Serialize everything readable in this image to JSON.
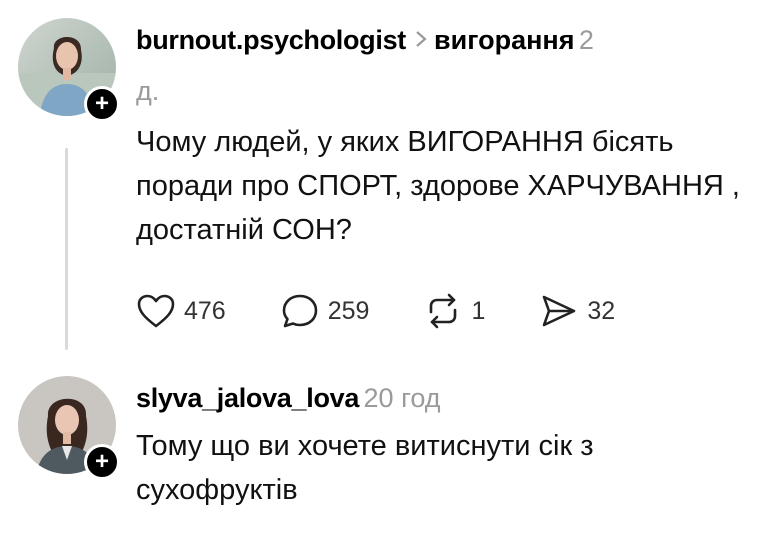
{
  "post": {
    "username": "burnout.psychologist",
    "topic": "вигорання",
    "time_line1": "2",
    "time_line2": "д.",
    "text": "Чому людей, у яких ВИГОРАННЯ бісять поради про СПОРТ, здорове ХАРЧУВАННЯ , достатній СОН?",
    "likes": "476",
    "comments": "259",
    "reposts": "1",
    "shares": "32"
  },
  "reply": {
    "username": "slyva_jalova_lova",
    "time": "20 год",
    "text": "Тому що ви хочете витиснути сік з сухофруктів"
  },
  "icons": {
    "follow": "plus-icon",
    "like": "heart-icon",
    "comment": "comment-bubble-icon",
    "repost": "repost-icon",
    "share": "send-icon",
    "chevron": "chevron-right-icon"
  }
}
